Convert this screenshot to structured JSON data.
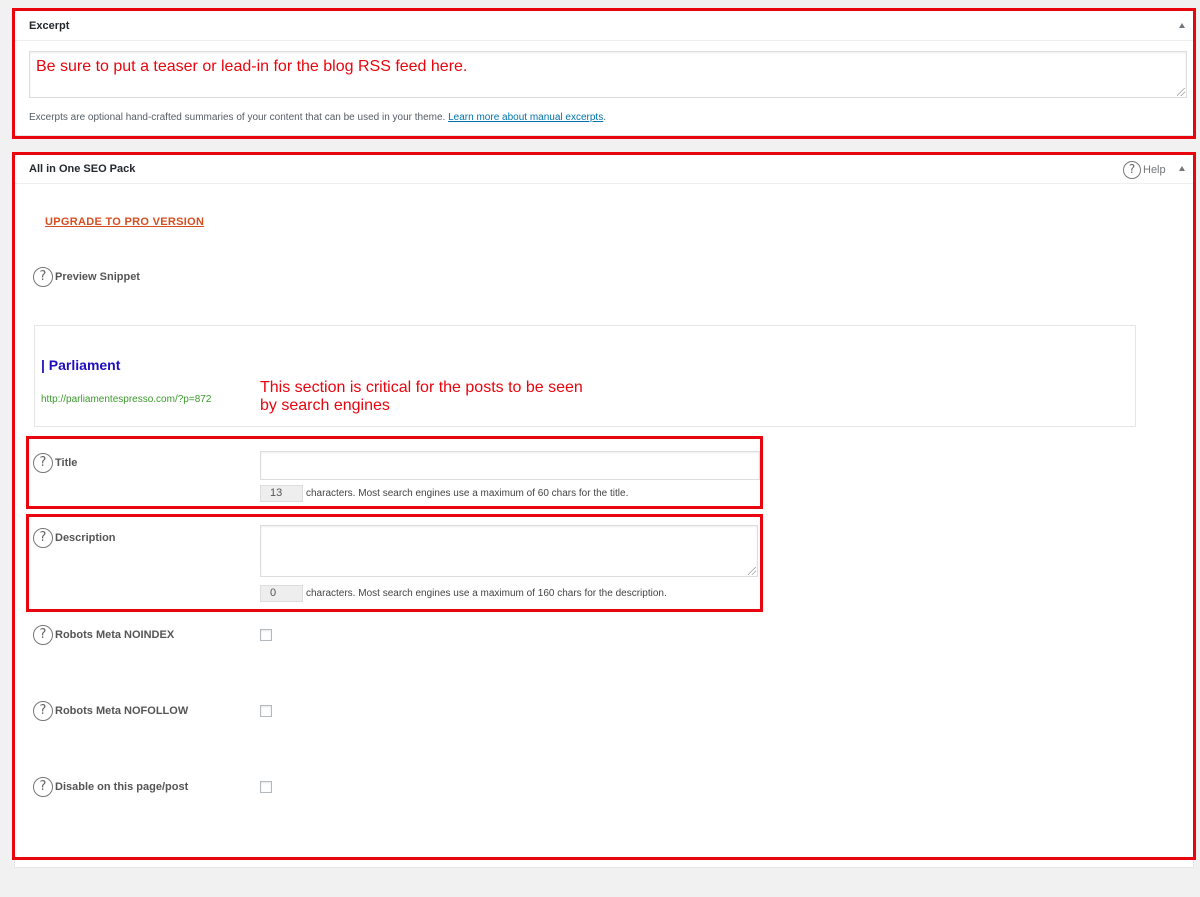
{
  "excerpt": {
    "title": "Excerpt",
    "value": "Be sure to put a teaser or lead-in for the blog RSS feed here.",
    "help_text": "Excerpts are optional hand-crafted summaries of your content that can be used in your theme.",
    "help_link": "Learn more about manual excerpts",
    "help_period": "."
  },
  "seo": {
    "title": "All in One SEO Pack",
    "help_label": "Help",
    "upgrade_label": "UPGRADE TO PRO VERSION",
    "preview": {
      "label": "Preview Snippet",
      "title": "| Parliament",
      "url": "http://parliamentespresso.com/?p=872"
    },
    "annotation": "This section is critical for the posts to be seen by search engines",
    "title_field": {
      "label": "Title",
      "value": "",
      "count": "13",
      "note": "characters. Most search engines use a maximum of 60 chars for the title."
    },
    "description_field": {
      "label": "Description",
      "value": "",
      "count": "0",
      "note": "characters. Most search engines use a maximum of 160 chars for the description."
    },
    "noindex_label": "Robots Meta NOINDEX",
    "nofollow_label": "Robots Meta NOFOLLOW",
    "disable_label": "Disable on this page/post"
  },
  "icons": {
    "question": "?",
    "question_icon_name": "question-circle-icon",
    "toggle_icon_name": "triangle-up-icon"
  },
  "colors": {
    "highlight_red": "#e8050e",
    "upgrade_orange": "#d54e21",
    "snippet_title_blue": "#1e0fbe",
    "snippet_url_green": "#3b9a2b",
    "link_blue": "#0073aa"
  }
}
